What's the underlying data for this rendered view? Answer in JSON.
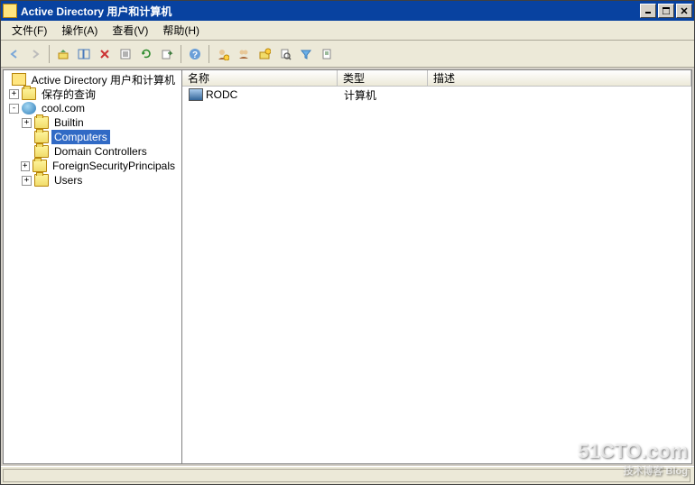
{
  "title": "Active Directory 用户和计算机",
  "menu": {
    "file": "文件(F)",
    "action": "操作(A)",
    "view": "查看(V)",
    "help": "帮助(H)"
  },
  "tree": {
    "root": "Active Directory 用户和计算机",
    "saved_queries": "保存的查询",
    "domain": "cool.com",
    "builtin": "Builtin",
    "computers": "Computers",
    "domain_controllers": "Domain Controllers",
    "foreign": "ForeignSecurityPrincipals",
    "users": "Users"
  },
  "columns": {
    "name": "名称",
    "type": "类型",
    "desc": "描述"
  },
  "row": {
    "name": "RODC",
    "type": "计算机",
    "desc": ""
  },
  "watermark": {
    "main": "51CTO.com",
    "sub": "技术博客 Blog"
  }
}
